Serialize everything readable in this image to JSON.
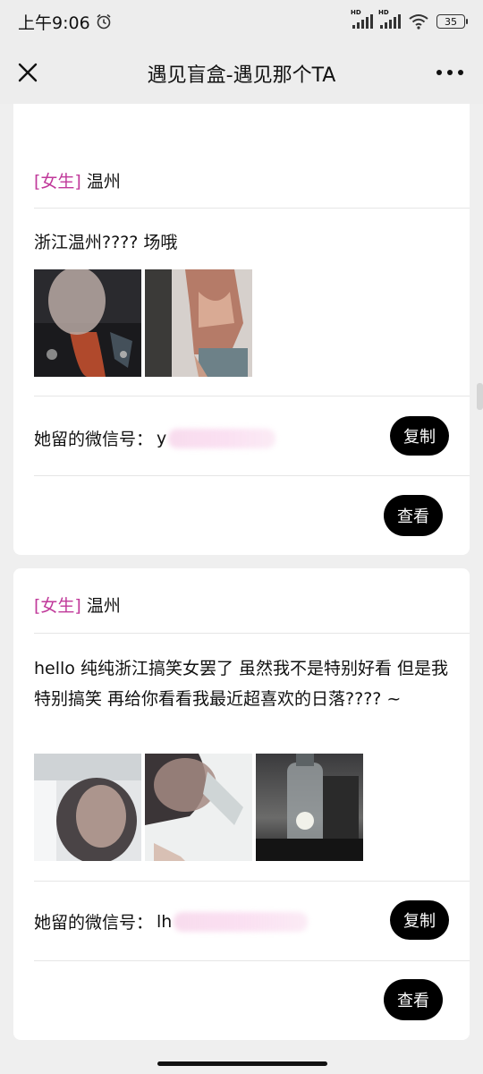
{
  "status_bar": {
    "time": "上午9:06",
    "network_1": "HD",
    "network_2": "HD",
    "battery": "35"
  },
  "nav": {
    "title": "遇见盲盒-遇见那个TA"
  },
  "cards": [
    {
      "gender": "[女生]",
      "city": "温州",
      "description": "浙江温州???? 场哦",
      "wechat_label": "她留的微信号：",
      "wechat_visible": "y",
      "copy_label": "复制",
      "view_label": "查看"
    },
    {
      "gender": "[女生]",
      "city": "温州",
      "description": "hello 纯纯浙江搞笑女罢了 虽然我不是特别好看 但是我特别搞笑 再给你看看我最近超喜欢的日落???? ~",
      "wechat_label": "她留的微信号：",
      "wechat_visible": "lh",
      "copy_label": "复制",
      "view_label": "查看"
    }
  ],
  "colors": {
    "gender_tag": "#c0399a",
    "button_bg": "#000000",
    "page_bg": "#efefef"
  }
}
